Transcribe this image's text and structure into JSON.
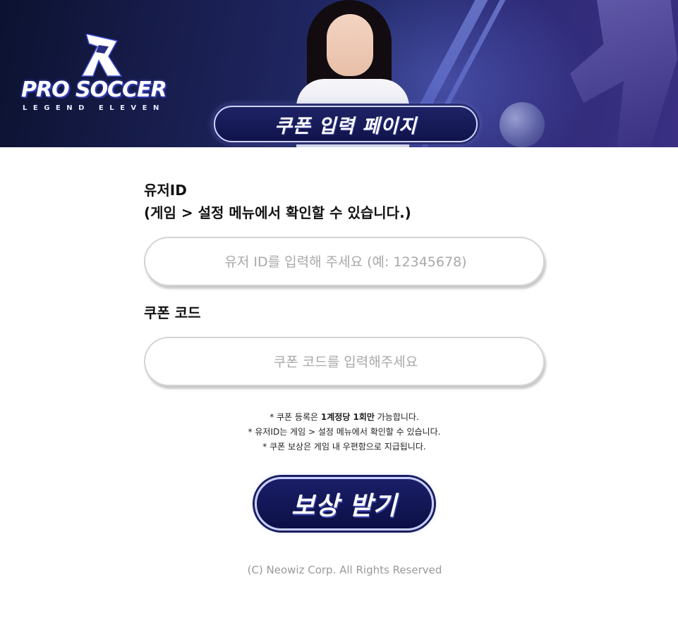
{
  "banner": {
    "logo_title": "PRO SOCCER",
    "logo_subtitle": "LEGEND ELEVEN",
    "page_title": "쿠폰 입력 페이지"
  },
  "form": {
    "user_id_label_line1": "유저ID",
    "user_id_label_line2": "(게임 > 설정 메뉴에서 확인할 수 있습니다.)",
    "user_id_placeholder": "유저 ID를 입력해 주세요 (예: 12345678)",
    "coupon_label": "쿠폰 코드",
    "coupon_placeholder": "쿠폰 코드를 입력해주세요"
  },
  "notes": {
    "line1_prefix": "* 쿠폰 등록은 ",
    "line1_bold": "1계정당 1회만",
    "line1_suffix": " 가능합니다.",
    "line2": "* 유저ID는 게임 > 설정 메뉴에서 확인할 수 있습니다.",
    "line3": "* 쿠폰 보상은 게임 내 우편함으로 지급됩니다."
  },
  "submit_label": "보상 받기",
  "footer": "(C) Neowiz Corp. All Rights Reserved",
  "colors": {
    "banner_dark": "#0c1230",
    "banner_purple": "#3a2f82",
    "button_navy": "#0c0f45",
    "placeholder_gray": "#a8a8a8"
  }
}
